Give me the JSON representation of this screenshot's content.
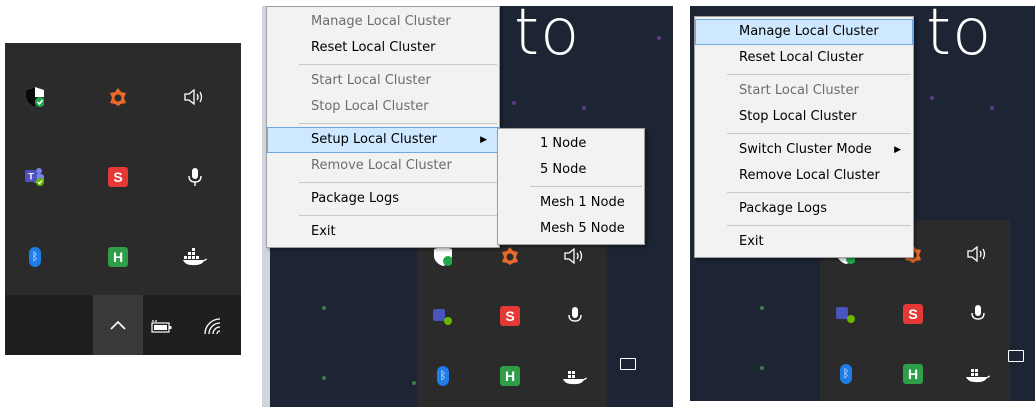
{
  "panel1": {
    "tray_icons": [
      "shield-icon",
      "gear-flower-icon",
      "speaker-icon",
      "teams-icon",
      "s-app-icon",
      "microphone-icon",
      "bluetooth-icon",
      "h-app-icon",
      "docker-icon"
    ],
    "taskbar_icons": [
      "chevron-up-icon",
      "battery-icon",
      "wifi-icon"
    ]
  },
  "panel2": {
    "background_text": "to",
    "menu": {
      "items": [
        {
          "label": "Manage Local Cluster",
          "disabled": true
        },
        {
          "label": "Reset Local Cluster",
          "disabled": false
        },
        {
          "label": "Start Local Cluster",
          "disabled": true
        },
        {
          "label": "Stop Local Cluster",
          "disabled": true
        },
        {
          "label": "Setup Local Cluster",
          "disabled": false,
          "submenu": true,
          "highlighted": true
        },
        {
          "label": "Remove Local Cluster",
          "disabled": true
        },
        {
          "label": "Package Logs",
          "disabled": false
        },
        {
          "label": "Exit",
          "disabled": false
        }
      ]
    },
    "submenu": {
      "items": [
        "1 Node",
        "5 Node",
        "Mesh 1 Node",
        "Mesh 5 Node"
      ]
    }
  },
  "panel3": {
    "background_text": "to",
    "menu": {
      "items": [
        {
          "label": "Manage Local Cluster",
          "highlighted": true
        },
        {
          "label": "Reset Local Cluster"
        },
        {
          "label": "Start Local Cluster",
          "disabled": true
        },
        {
          "label": "Stop Local Cluster"
        },
        {
          "label": "Switch Cluster Mode",
          "submenu": true
        },
        {
          "label": "Remove Local Cluster"
        },
        {
          "label": "Package Logs"
        },
        {
          "label": "Exit"
        }
      ]
    }
  },
  "colors": {
    "tray_bg": "#2b2b2b",
    "menu_bg": "#f2f2f2",
    "highlight": "#cde8ff",
    "desktop_bg": "#1d2433"
  }
}
